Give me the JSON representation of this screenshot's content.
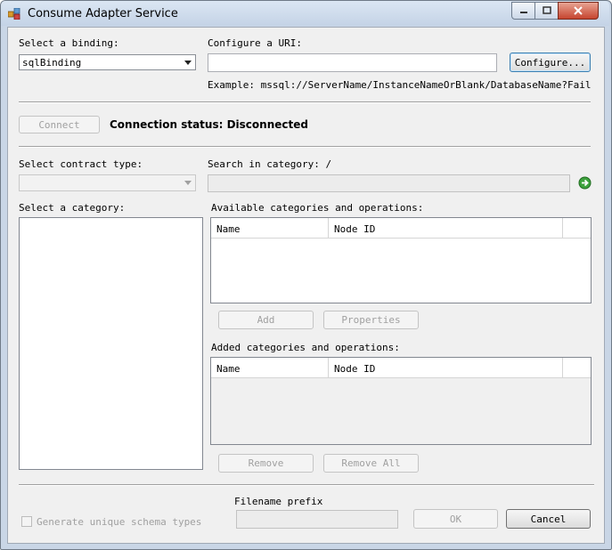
{
  "window": {
    "title": "Consume Adapter Service",
    "icons": {
      "app": "adapter-service-icon",
      "minimize": "minimize-icon",
      "maximize": "maximize-icon",
      "close": "close-icon"
    }
  },
  "binding": {
    "label": "Select a binding:",
    "selected": "sqlBinding"
  },
  "uri": {
    "label": "Configure a URI:",
    "value": "",
    "configure_button": "Configure...",
    "example": "Example: mssql://ServerName/InstanceNameOrBlank/DatabaseName?FailoverPar"
  },
  "connection": {
    "connect_button": "Connect",
    "status_text": "Connection status: Disconnected"
  },
  "contract": {
    "label": "Select contract type:",
    "selected": ""
  },
  "search": {
    "label": "Search in category: /",
    "value": "",
    "go_icon": "green-arrow-go-icon"
  },
  "category": {
    "label": "Select a category:"
  },
  "available": {
    "label": "Available categories and operations:",
    "columns": [
      "Name",
      "Node ID"
    ]
  },
  "added": {
    "label": "Added categories and operations:",
    "columns": [
      "Name",
      "Node ID"
    ]
  },
  "buttons": {
    "add": "Add",
    "properties": "Properties",
    "remove": "Remove",
    "remove_all": "Remove All",
    "ok": "OK",
    "cancel": "Cancel"
  },
  "footer": {
    "filename_prefix_label": "Filename prefix",
    "filename_prefix_value": "",
    "generate_unique_label": "Generate unique schema types",
    "generate_unique_checked": false
  }
}
